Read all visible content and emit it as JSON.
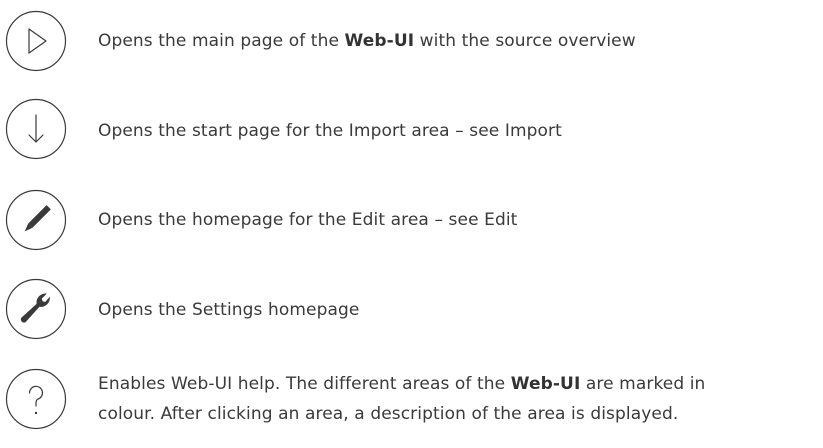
{
  "help_items": [
    {
      "icon": "play-icon",
      "text_before": "Opens the main page of the ",
      "bold": "Web-UI",
      "text_after": " with the source overview"
    },
    {
      "icon": "import-arrow-icon",
      "text": "Opens the start page for the Import area – see Import"
    },
    {
      "icon": "pencil-icon",
      "text": "Opens the homepage for the Edit area – see Edit"
    },
    {
      "icon": "wrench-icon",
      "text": "Opens the Settings homepage"
    },
    {
      "icon": "question-mark-icon",
      "line1_before": "Enables Web-UI help. The different areas of the ",
      "line1_bold": "Web-UI",
      "line1_after": " are marked in",
      "line2": "colour. After clicking an area, a description of the area is displayed."
    }
  ],
  "colors": {
    "text": "#3a3a3a",
    "icon_stroke": "#3a3a3a"
  }
}
